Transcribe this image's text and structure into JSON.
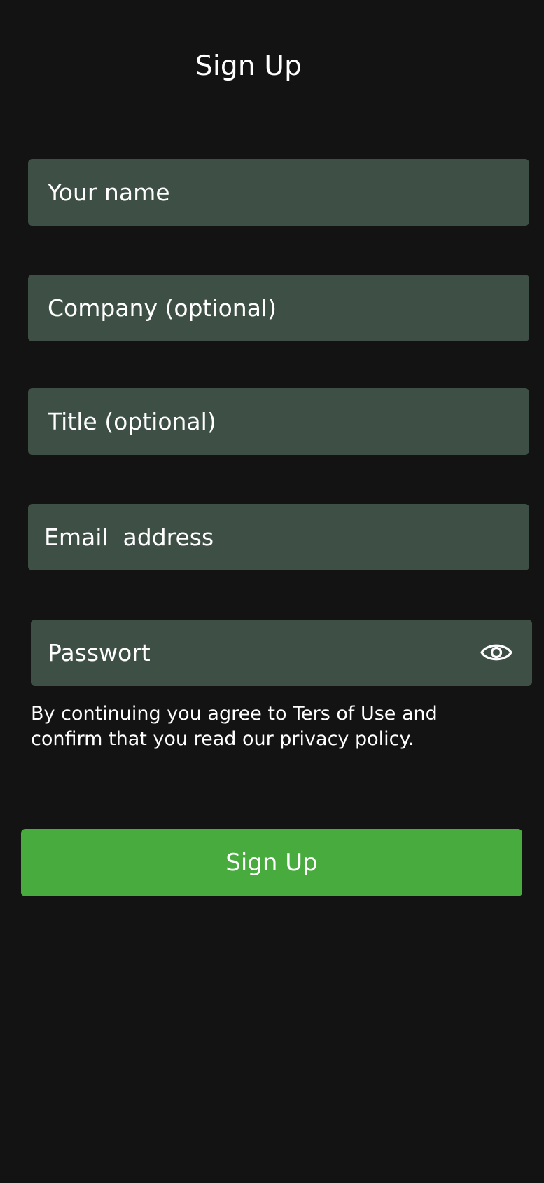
{
  "header": {
    "title": "Sign Up"
  },
  "form": {
    "name_placeholder": "Your name",
    "company_placeholder": "Company (optional)",
    "title_placeholder": "Title (optional)",
    "email_placeholder": "Email  address",
    "password_placeholder": "Passwort",
    "password_toggle_icon": "eye-icon",
    "terms_text": "By continuing you agree to Ters of Use and confirm that you read our privacy policy.",
    "submit_label": "Sign Up"
  },
  "colors": {
    "background": "#131313",
    "field_background": "#3e5046",
    "accent": "#48ab3e",
    "text": "#ffffff"
  }
}
